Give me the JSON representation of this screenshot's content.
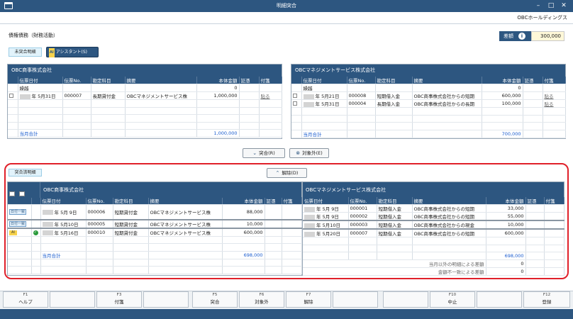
{
  "window": {
    "title": "明細突合",
    "company": "OBCホールディングス"
  },
  "header": {
    "category": "債権債務（財務活動）",
    "diff_label": "差額",
    "diff_info": "i",
    "diff_value": "300,000"
  },
  "tabs": {
    "unmatched": "未突合明細",
    "assistant_badge": "AI",
    "assistant": "アシスタント(S)",
    "matched": "突合済明細"
  },
  "columns": {
    "date": "伝票日付",
    "no": "伝票No.",
    "account": "勘定科目",
    "memo": "摘要",
    "amount": "本体金額",
    "evidence": "証憑",
    "tag": "付箋"
  },
  "left_panel": {
    "title": "OBC商事株式会社",
    "carryover_label": "繰越",
    "carryover_value": "0",
    "rows": [
      {
        "date": "年  5月31日",
        "no": "000007",
        "account": "長期貸付金",
        "memo": "OBCマネジメントサービス株",
        "amount": "1,000,000",
        "evidence": "",
        "tag": "貼る"
      }
    ],
    "total_label": "当月合計",
    "total_value": "1,000,000"
  },
  "right_panel": {
    "title": "OBCマネジメントサービス株式会社",
    "carryover_label": "繰越",
    "carryover_value": "0",
    "rows": [
      {
        "date": "年  5月21日",
        "no": "000008",
        "account": "短期借入金",
        "memo": "OBC商事株式会社からの短期",
        "amount": "600,000",
        "evidence": "",
        "tag": "貼る"
      },
      {
        "date": "年  5月31日",
        "no": "000004",
        "account": "長期借入金",
        "memo": "OBC商事株式会社からの長期",
        "amount": "100,000",
        "evidence": "",
        "tag": "貼る"
      }
    ],
    "total_label": "当月合計",
    "total_value": "700,000"
  },
  "actions": {
    "match": "突合(R)",
    "exclude": "対象外(E)",
    "release": "解除(D)"
  },
  "matched": {
    "left_title": "OBC商事株式会社",
    "right_title": "OBCマネジメントサービス株式会社",
    "groups": [
      {
        "tag": "日付一致",
        "left": [
          {
            "date": "年  5月  9日",
            "no": "000006",
            "account": "短期貸付金",
            "memo": "OBCマネジメントサービス株",
            "amount": "88,000"
          }
        ],
        "right": [
          {
            "date": "年  5月  9日",
            "no": "000001",
            "account": "短期借入金",
            "memo": "OBC商事株式会社からの短期",
            "amount": "33,000"
          },
          {
            "date": "年  5月  9日",
            "no": "000002",
            "account": "短期借入金",
            "memo": "OBC商事株式会社からの短期",
            "amount": "55,000"
          }
        ]
      },
      {
        "tag": "日付一致",
        "left": [
          {
            "date": "年  5月10日",
            "no": "000005",
            "account": "短期貸付金",
            "memo": "OBCマネジメントサービス株",
            "amount": "10,000"
          }
        ],
        "right": [
          {
            "date": "年  5月10日",
            "no": "000003",
            "account": "短期借入金",
            "memo": "OBC商事株式会社からの現金",
            "amount": "10,000"
          }
        ]
      },
      {
        "tag": "AI",
        "left": [
          {
            "date": "年  5月16日",
            "no": "000010",
            "account": "短期貸付金",
            "memo": "OBCマネジメントサービス株",
            "amount": "600,000"
          }
        ],
        "right": [
          {
            "date": "年  5月20日",
            "no": "000007",
            "account": "短期借入金",
            "memo": "OBC商事株式会社からの短期",
            "amount": "600,000"
          }
        ]
      }
    ],
    "left_total_label": "当月合計",
    "left_total": "698,000",
    "right_total_label": "当月合計",
    "right_total": "698,000",
    "diff_other_label": "当月以外の明細による差額",
    "diff_other": "0",
    "diff_amount_label": "金額不一致による差額",
    "diff_amount": "0"
  },
  "fkeys": [
    {
      "key": "F1",
      "label": "ヘルプ"
    },
    {
      "key": "",
      "label": ""
    },
    {
      "key": "F3",
      "label": "付箋"
    },
    {
      "key": "",
      "label": ""
    },
    {
      "key": "F5",
      "label": "突合"
    },
    {
      "key": "F6",
      "label": "対象外"
    },
    {
      "key": "F7",
      "label": "解除"
    },
    {
      "key": "",
      "label": ""
    },
    {
      "key": "",
      "label": ""
    },
    {
      "key": "F10",
      "label": "中止"
    },
    {
      "key": "",
      "label": ""
    },
    {
      "key": "F12",
      "label": "登録"
    }
  ],
  "colors": {
    "accent": "#2d5680",
    "highlight": "#e0202a"
  }
}
